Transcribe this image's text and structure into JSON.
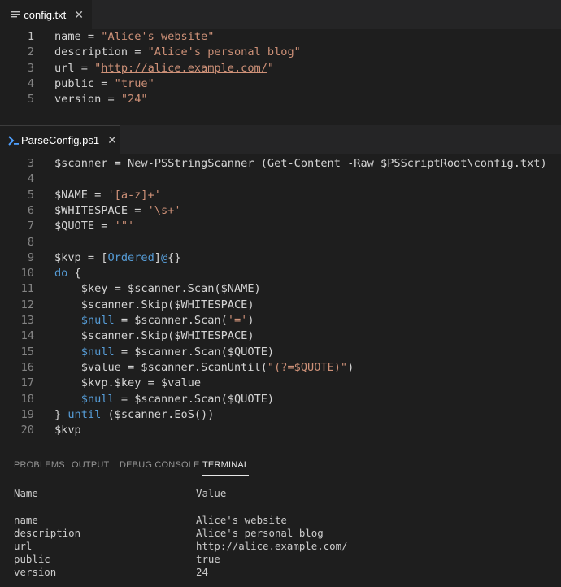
{
  "editor_top": {
    "tab": {
      "label": "config.txt",
      "close": "✕",
      "icon": "file-icon"
    },
    "lines": [
      {
        "n": "1",
        "parts": [
          {
            "t": "name = ",
            "c": "var"
          },
          {
            "t": "\"Alice's website\"",
            "c": "str"
          }
        ]
      },
      {
        "n": "2",
        "parts": [
          {
            "t": "description = ",
            "c": "var"
          },
          {
            "t": "\"Alice's personal blog\"",
            "c": "str"
          }
        ]
      },
      {
        "n": "3",
        "parts": [
          {
            "t": "url = ",
            "c": "var"
          },
          {
            "t": "\"",
            "c": "str"
          },
          {
            "t": "http://alice.example.com/",
            "c": "url"
          },
          {
            "t": "\"",
            "c": "str"
          }
        ]
      },
      {
        "n": "4",
        "parts": [
          {
            "t": "public = ",
            "c": "var"
          },
          {
            "t": "\"true\"",
            "c": "str"
          }
        ]
      },
      {
        "n": "5",
        "parts": [
          {
            "t": "version = ",
            "c": "var"
          },
          {
            "t": "\"24\"",
            "c": "str"
          }
        ]
      }
    ]
  },
  "editor_bottom": {
    "tab": {
      "label": "ParseConfig.ps1",
      "close": "✕",
      "icon": "powershell-icon"
    },
    "lines": [
      {
        "n": "3",
        "parts": [
          {
            "t": "$scanner = New-PSStringScanner (Get-Content -Raw $PSScriptRoot\\config.txt)",
            "c": "var"
          }
        ]
      },
      {
        "n": "4",
        "parts": []
      },
      {
        "n": "5",
        "parts": [
          {
            "t": "$NAME = ",
            "c": "var"
          },
          {
            "t": "'[a-z]+'",
            "c": "str"
          }
        ]
      },
      {
        "n": "6",
        "parts": [
          {
            "t": "$WHITESPACE = ",
            "c": "var"
          },
          {
            "t": "'\\s+'",
            "c": "str"
          }
        ]
      },
      {
        "n": "7",
        "parts": [
          {
            "t": "$QUOTE = ",
            "c": "var"
          },
          {
            "t": "'\"'",
            "c": "str"
          }
        ]
      },
      {
        "n": "8",
        "parts": []
      },
      {
        "n": "9",
        "parts": [
          {
            "t": "$kvp = [",
            "c": "var"
          },
          {
            "t": "Ordered",
            "c": "kw"
          },
          {
            "t": "]",
            "c": "var"
          },
          {
            "t": "@",
            "c": "kw"
          },
          {
            "t": "{}",
            "c": "var"
          }
        ]
      },
      {
        "n": "10",
        "parts": [
          {
            "t": "do",
            "c": "kw"
          },
          {
            "t": " {",
            "c": "var"
          }
        ]
      },
      {
        "n": "11",
        "parts": [
          {
            "t": "    $key = $scanner.Scan($NAME)",
            "c": "var"
          }
        ]
      },
      {
        "n": "12",
        "parts": [
          {
            "t": "    $scanner.Skip($WHITESPACE)",
            "c": "var"
          }
        ]
      },
      {
        "n": "13",
        "parts": [
          {
            "t": "    ",
            "c": "var"
          },
          {
            "t": "$null",
            "c": "kw"
          },
          {
            "t": " = $scanner.Scan(",
            "c": "var"
          },
          {
            "t": "'='",
            "c": "str"
          },
          {
            "t": ")",
            "c": "var"
          }
        ]
      },
      {
        "n": "14",
        "parts": [
          {
            "t": "    $scanner.Skip($WHITESPACE)",
            "c": "var"
          }
        ]
      },
      {
        "n": "15",
        "parts": [
          {
            "t": "    ",
            "c": "var"
          },
          {
            "t": "$null",
            "c": "kw"
          },
          {
            "t": " = $scanner.Scan($QUOTE)",
            "c": "var"
          }
        ]
      },
      {
        "n": "16",
        "parts": [
          {
            "t": "    $value = $scanner.ScanUntil(",
            "c": "var"
          },
          {
            "t": "\"(?=$QUOTE)\"",
            "c": "str"
          },
          {
            "t": ")",
            "c": "var"
          }
        ]
      },
      {
        "n": "17",
        "parts": [
          {
            "t": "    $kvp.$key = $value",
            "c": "var"
          }
        ]
      },
      {
        "n": "18",
        "parts": [
          {
            "t": "    ",
            "c": "var"
          },
          {
            "t": "$null",
            "c": "kw"
          },
          {
            "t": " = $scanner.Scan($QUOTE)",
            "c": "var"
          }
        ]
      },
      {
        "n": "19",
        "parts": [
          {
            "t": "} ",
            "c": "var"
          },
          {
            "t": "until",
            "c": "kw"
          },
          {
            "t": " ($scanner.EoS())",
            "c": "var"
          }
        ]
      },
      {
        "n": "20",
        "parts": [
          {
            "t": "$kvp",
            "c": "var"
          }
        ]
      }
    ]
  },
  "panel": {
    "tabs": [
      {
        "label": "PROBLEMS",
        "active": false
      },
      {
        "label": "OUTPUT",
        "active": false
      },
      {
        "label": "DEBUG CONSOLE",
        "active": false
      },
      {
        "label": "TERMINAL",
        "active": true
      }
    ],
    "terminal": {
      "headers": [
        "Name",
        "Value"
      ],
      "underline": [
        "----",
        "-----"
      ],
      "rows": [
        [
          "name",
          "Alice's website"
        ],
        [
          "description",
          "Alice's personal blog"
        ],
        [
          "url",
          "http://alice.example.com/"
        ],
        [
          "public",
          "true"
        ],
        [
          "version",
          "24"
        ]
      ]
    }
  }
}
